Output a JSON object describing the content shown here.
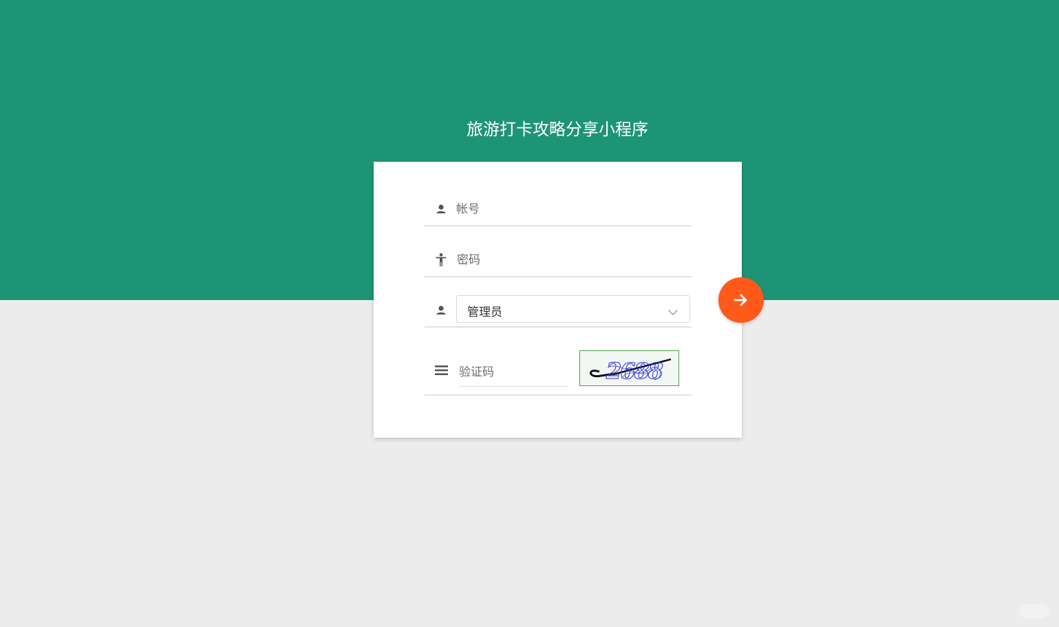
{
  "app": {
    "title": "旅游打卡攻略分享小程序"
  },
  "login_form": {
    "account": {
      "placeholder": "帐号",
      "value": "",
      "icon": "user-icon"
    },
    "password": {
      "placeholder": "密码",
      "value": "",
      "icon": "person-standing-icon"
    },
    "role": {
      "selected": "管理员",
      "icon": "user-icon",
      "dropdown_icon": "chevron-down-icon"
    },
    "captcha": {
      "placeholder": "验证码",
      "value": "",
      "icon": "menu-lines-icon",
      "image_text": "2688"
    },
    "submit": {
      "icon": "arrow-right-icon"
    }
  },
  "colors": {
    "header_bg": "#1e9477",
    "page_bg": "#ececec",
    "submit_bg": "#ff5a1a",
    "card_bg": "#ffffff"
  }
}
